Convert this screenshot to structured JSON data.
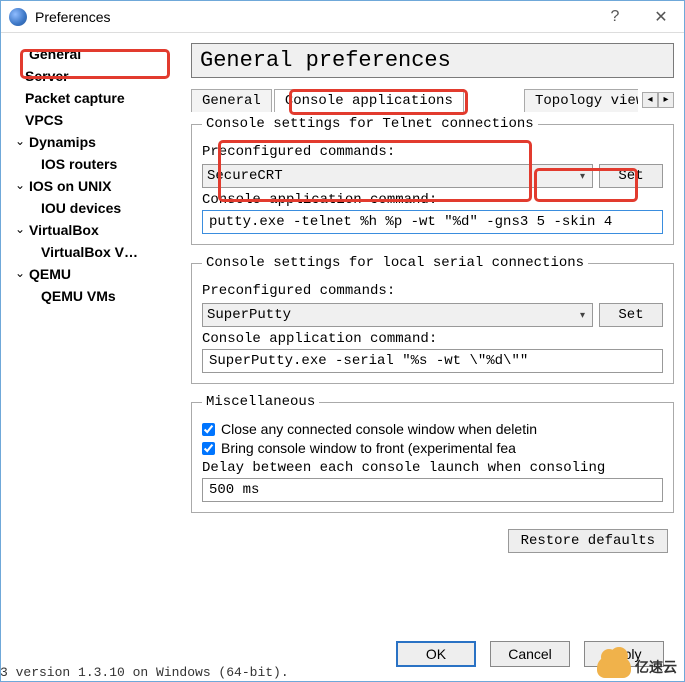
{
  "window": {
    "title": "Preferences",
    "help_glyph": "?",
    "close_glyph": "✕"
  },
  "sidebar": {
    "items": [
      {
        "label": "General",
        "name": "sidebar-item-general",
        "indent": 0,
        "arrow": ""
      },
      {
        "label": "Server",
        "name": "sidebar-item-server",
        "indent": 1,
        "arrow": ""
      },
      {
        "label": "Packet capture",
        "name": "sidebar-item-packet-capture",
        "indent": 1,
        "arrow": ""
      },
      {
        "label": "VPCS",
        "name": "sidebar-item-vpcs",
        "indent": 1,
        "arrow": ""
      },
      {
        "label": "Dynamips",
        "name": "sidebar-item-dynamips",
        "indent": 0,
        "arrow": "⌄"
      },
      {
        "label": "IOS routers",
        "name": "sidebar-item-ios-routers",
        "indent": 2,
        "arrow": ""
      },
      {
        "label": "IOS on UNIX",
        "name": "sidebar-item-ios-on-unix",
        "indent": 0,
        "arrow": "⌄"
      },
      {
        "label": "IOU devices",
        "name": "sidebar-item-iou-devices",
        "indent": 2,
        "arrow": ""
      },
      {
        "label": "VirtualBox",
        "name": "sidebar-item-virtualbox",
        "indent": 0,
        "arrow": "⌄"
      },
      {
        "label": "VirtualBox V…",
        "name": "sidebar-item-virtualbox-vms",
        "indent": 2,
        "arrow": ""
      },
      {
        "label": "QEMU",
        "name": "sidebar-item-qemu",
        "indent": 0,
        "arrow": "⌄"
      },
      {
        "label": "QEMU VMs",
        "name": "sidebar-item-qemu-vms",
        "indent": 2,
        "arrow": ""
      }
    ]
  },
  "page": {
    "title": "General preferences",
    "tabs": {
      "general": "General",
      "console": "Console applications",
      "topology": "Topology view"
    },
    "scroll_left": "◂",
    "scroll_right": "▸"
  },
  "telnet": {
    "legend": "Console settings for Telnet connections",
    "pre_label": "Preconfigured commands:",
    "pre_value": "SecureCRT",
    "set_label": "Set",
    "cmd_label": "Console application command:",
    "cmd_value": "putty.exe -telnet %h %p -wt \"%d\" -gns3 5 -skin 4"
  },
  "serial": {
    "legend": "Console settings for local serial connections",
    "pre_label": "Preconfigured commands:",
    "pre_value": "SuperPutty",
    "set_label": "Set",
    "cmd_label": "Console application command:",
    "cmd_value": "SuperPutty.exe -serial \"%s -wt \\\"%d\\\"\""
  },
  "misc": {
    "legend": "Miscellaneous",
    "close_label": "Close any connected console window when deletin",
    "front_label": "Bring console window to front (experimental fea",
    "delay_label": "Delay between each console launch when consoling",
    "delay_value": "500 ms"
  },
  "actions": {
    "restore": "Restore defaults",
    "ok": "OK",
    "cancel": "Cancel",
    "apply": "Apply"
  },
  "status": {
    "version_text": "3 version 1.3.10 on Windows (64-bit).",
    "brand_text": "亿速云"
  }
}
